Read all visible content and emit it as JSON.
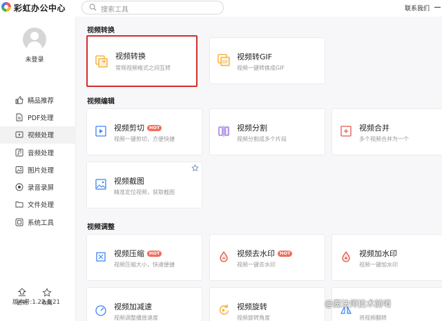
{
  "app": {
    "title": "彩虹办公中心",
    "contact": "联系我们"
  },
  "search": {
    "placeholder": "搜索工具"
  },
  "user": {
    "status": "未登录"
  },
  "sidebar": {
    "items": [
      {
        "label": "精品推荐",
        "icon": "thumbs-up-icon",
        "active": false
      },
      {
        "label": "PDF处理",
        "icon": "pdf-file-icon",
        "active": false
      },
      {
        "label": "视频处理",
        "icon": "video-icon",
        "active": true
      },
      {
        "label": "音频处理",
        "icon": "audio-icon",
        "active": false
      },
      {
        "label": "图片处理",
        "icon": "image-icon",
        "active": false
      },
      {
        "label": "录音录屏",
        "icon": "record-icon",
        "active": false
      },
      {
        "label": "文件处理",
        "icon": "folder-icon",
        "active": false
      },
      {
        "label": "系统工具",
        "icon": "system-tool-icon",
        "active": false
      }
    ],
    "update_label": "更新",
    "favorite_label": "收藏",
    "version": "版本号:1.22.8.21"
  },
  "sections": {
    "convert": {
      "title": "视频转换"
    },
    "edit": {
      "title": "视频编辑"
    },
    "adjust": {
      "title": "视频调整"
    }
  },
  "cards": {
    "video_convert": {
      "title": "视频转换",
      "desc": "常规视频格式之间互转",
      "icon": "video-convert-icon"
    },
    "video_to_gif": {
      "title": "视频转GIF",
      "desc": "视频一键转换成GIF",
      "icon": "gif-icon"
    },
    "video_cut": {
      "title": "视频剪切",
      "desc": "视频一键剪切，方便快捷",
      "badge": "HOT",
      "icon": "video-cut-icon"
    },
    "video_split": {
      "title": "视频分割",
      "desc": "视频分割成多个片段",
      "icon": "video-split-icon"
    },
    "video_merge": {
      "title": "视频合并",
      "desc": "多个视频合并为一个",
      "icon": "video-merge-icon"
    },
    "video_screenshot": {
      "title": "视频截图",
      "desc": "精准定位视频，获取截图",
      "icon": "video-screenshot-icon"
    },
    "video_compress": {
      "title": "视频压缩",
      "desc": "视频压缩大小，快速便捷",
      "badge": "HOT",
      "icon": "video-compress-icon"
    },
    "video_remove_watermark": {
      "title": "视频去水印",
      "desc": "视频一键去水印",
      "badge": "HOT",
      "icon": "remove-watermark-icon"
    },
    "video_add_watermark": {
      "title": "视频加水印",
      "desc": "视频一键加水印",
      "icon": "add-watermark-icon"
    },
    "video_speed": {
      "title": "视频加减速",
      "desc": "视频调整播放速度",
      "icon": "speed-icon"
    },
    "video_rotate": {
      "title": "视频旋转",
      "desc": "视频旋转角度",
      "icon": "rotate-icon"
    },
    "video_flip": {
      "desc": "将视频翻转",
      "icon": "flip-icon"
    }
  },
  "watermark": "@魔法师技术前哨",
  "colors": {
    "selected_border": "#d32c2c",
    "accent_orange": "#f5a623",
    "hot_badge": "#f26b5b",
    "active_nav": "#f2f2f2"
  }
}
